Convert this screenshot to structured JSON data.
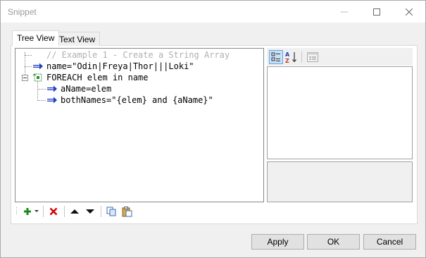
{
  "window": {
    "title": "Snippet"
  },
  "tabs": [
    {
      "label": "Tree View"
    },
    {
      "label": "Text View"
    }
  ],
  "tree": {
    "nodes": [
      {
        "text": "// Example 1 - Create a String Array",
        "kind": "comment"
      },
      {
        "text": "name=\"Odin|Freya|Thor|||Loki\"",
        "kind": "assign"
      },
      {
        "text": "FOREACH elem in name",
        "kind": "loop"
      },
      {
        "text": "aName=elem",
        "kind": "assign"
      },
      {
        "text": "bothNames=\"{elem} and {aName}\"",
        "kind": "assign"
      }
    ]
  },
  "tree_toolbar": {
    "items": [
      {
        "icon": "add-icon"
      },
      {
        "icon": "dropdown-arrow-icon"
      },
      {
        "icon": "delete-icon"
      },
      {
        "icon": "move-up-icon"
      },
      {
        "icon": "move-down-icon"
      },
      {
        "icon": "copy-icon"
      },
      {
        "icon": "paste-icon"
      }
    ]
  },
  "property_grid": {
    "toolbar": [
      {
        "icon": "categorized-icon",
        "selected": true
      },
      {
        "icon": "sort-alphabetical-icon",
        "selected": false
      },
      {
        "icon": "property-pages-icon",
        "selected": false
      }
    ]
  },
  "buttons": {
    "apply": "Apply",
    "ok": "OK",
    "cancel": "Cancel"
  },
  "colors": {
    "assign_arrow": "#1f3fbf",
    "loop_icon": "#2e8b2e",
    "delete": "#d40000",
    "add": "#1a8a1a",
    "comment_text": "#b0b0b0"
  }
}
